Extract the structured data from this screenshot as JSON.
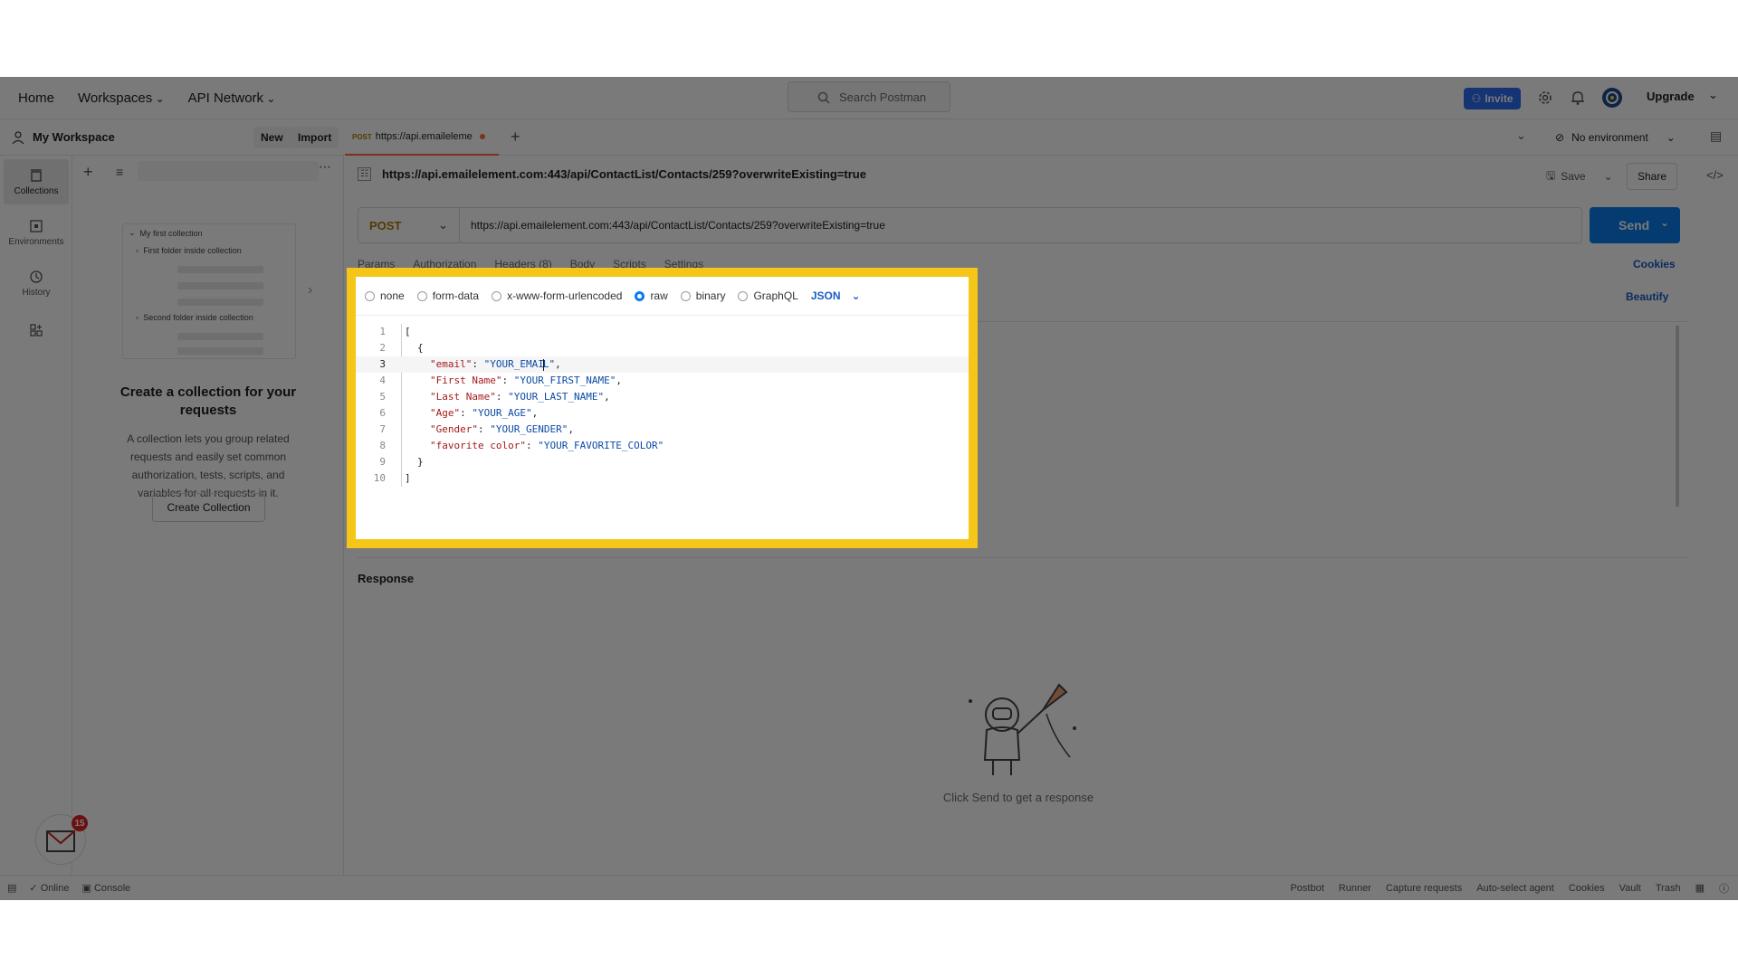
{
  "topbar": {
    "nav": [
      "Home",
      "Workspaces",
      "API Network"
    ],
    "search_placeholder": "Search Postman",
    "invite_label": "Invite",
    "upgrade_label": "Upgrade"
  },
  "workspace": {
    "name": "My Workspace",
    "new_label": "New",
    "import_label": "Import"
  },
  "rail": [
    {
      "label": "Collections",
      "icon": "collections-icon"
    },
    {
      "label": "Environments",
      "icon": "environments-icon"
    },
    {
      "label": "History",
      "icon": "history-icon"
    }
  ],
  "mini_collection": {
    "title": "My first collection",
    "folder1": "First folder inside collection",
    "folder2": "Second folder inside collection"
  },
  "empty_state": {
    "title": "Create a collection for your requests",
    "description": "A collection lets you group related requests and easily set common authorization, tests, scripts, and variables for all requests in it.",
    "button": "Create Collection"
  },
  "tab": {
    "method": "POST",
    "title": "https://api.emaileleme"
  },
  "environment": "No environment",
  "request": {
    "heading_url": "https://api.emailelement.com:443/api/ContactList/Contacts/259?overwriteExisting=true",
    "method": "POST",
    "url": "https://api.emailelement.com:443/api/ContactList/Contacts/259?overwriteExisting=true",
    "save_label": "Save",
    "share_label": "Share",
    "send_label": "Send"
  },
  "subtabs": [
    "Params",
    "Authorization",
    "Headers (8)",
    "Body",
    "Scripts",
    "Settings"
  ],
  "cookies_label": "Cookies",
  "beautify_label": "Beautify",
  "body_types": [
    "none",
    "form-data",
    "x-www-form-urlencoded",
    "raw",
    "binary",
    "GraphQL"
  ],
  "body_type_selected": "raw",
  "body_format": "JSON",
  "code": {
    "line_numbers": [
      "1",
      "2",
      "3",
      "4",
      "5",
      "6",
      "7",
      "8",
      "9",
      "10"
    ],
    "l1": "[",
    "l2": "{",
    "l3k": "\"email\"",
    "l3v_a": "\"YOUR_EMAI",
    "l3v_b": "L\"",
    "l4k": "\"First Name\"",
    "l4v": "\"YOUR_FIRST_NAME\"",
    "l5k": "\"Last Name\"",
    "l5v": "\"YOUR_LAST_NAME\"",
    "l6k": "\"Age\"",
    "l6v": "\"YOUR_AGE\"",
    "l7k": "\"Gender\"",
    "l7v": "\"YOUR_GENDER\"",
    "l8k": "\"favorite color\"",
    "l8v": "\"YOUR_FAVORITE_COLOR\"",
    "l9": "}",
    "l10": "]"
  },
  "response": {
    "title": "Response",
    "hint": "Click Send to get a response"
  },
  "notification_count": "15",
  "statusbar": {
    "left": [
      "Online",
      "Console"
    ],
    "right": [
      "Postbot",
      "Runner",
      "Capture requests",
      "Auto-select agent",
      "Cookies",
      "Vault",
      "Trash"
    ]
  },
  "colors": {
    "highlight_border": "#f5c518",
    "send": "#097bed",
    "method": "#ad7a03",
    "accent": "#ff6c37"
  }
}
